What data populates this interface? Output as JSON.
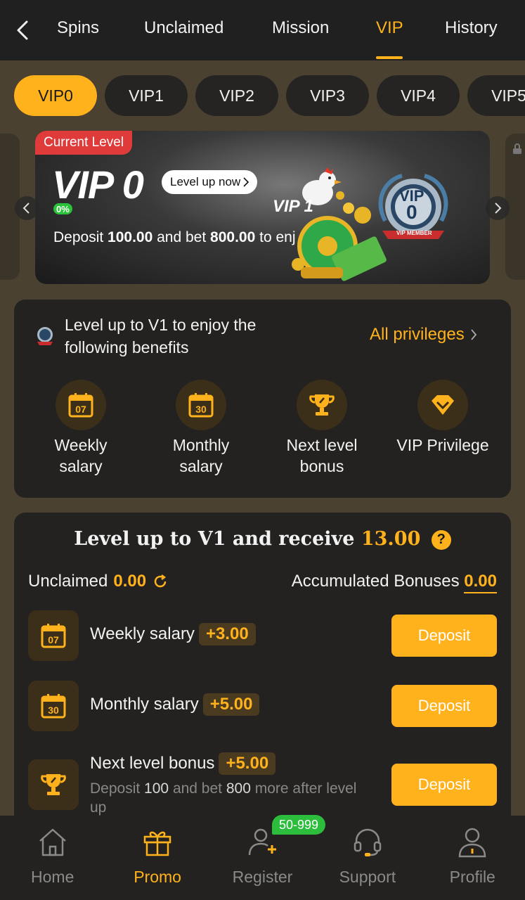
{
  "topnav": {
    "tabs": [
      {
        "label": "Spins"
      },
      {
        "label": "Unclaimed"
      },
      {
        "label": "Mission"
      },
      {
        "label": "VIP"
      },
      {
        "label": "History"
      }
    ],
    "active_tab": "VIP"
  },
  "vip_pills": [
    "VIP0",
    "VIP1",
    "VIP2",
    "VIP3",
    "VIP4",
    "VIP5"
  ],
  "active_pill": "VIP0",
  "banner": {
    "badge": "Current Level",
    "level": "VIP 0",
    "level_up_button": "Level up now",
    "progress": "0%",
    "progress_value": 0,
    "next_level_label": "VIP 1",
    "desc_prefix": "Deposit",
    "deposit_amount": "100.00",
    "desc_mid": "and bet",
    "bet_amount": "800.00",
    "desc_suffix": "to enj",
    "medal_text": "VIP",
    "medal_number": "0",
    "medal_ribbon": "VIP MEMBER"
  },
  "benefits": {
    "heading": "Level up to V1 to enjoy the following benefits",
    "all_privileges": "All privileges",
    "items": [
      {
        "label": "Weekly salary",
        "icon": "calendar-07-icon",
        "day": "07"
      },
      {
        "label": "Monthly salary",
        "icon": "calendar-30-icon",
        "day": "30"
      },
      {
        "label": "Next level bonus",
        "icon": "trophy-icon"
      },
      {
        "label": "VIP Privilege",
        "icon": "diamond-icon"
      }
    ]
  },
  "rewards": {
    "title_prefix": "Level up to V1 and receive",
    "title_amount": "13.00",
    "help": "?",
    "unclaimed_label": "Unclaimed",
    "unclaimed_value": "0.00",
    "accumulated_label": "Accumulated Bonuses",
    "accumulated_value": "0.00",
    "rows": [
      {
        "name": "Weekly salary",
        "amount": "+3.00",
        "button": "Deposit",
        "day": "07"
      },
      {
        "name": "Monthly salary",
        "amount": "+5.00",
        "button": "Deposit",
        "day": "30"
      },
      {
        "name": "Next level bonus",
        "amount": "+5.00",
        "button": "Deposit",
        "sub_prefix": "Deposit",
        "sub_deposit": "100",
        "sub_mid": "and bet",
        "sub_bet": "800",
        "sub_suffix": "more after level up"
      }
    ]
  },
  "bottombar": {
    "items": [
      {
        "label": "Home",
        "icon": "home-icon"
      },
      {
        "label": "Promo",
        "icon": "gift-icon"
      },
      {
        "label": "Register",
        "icon": "add-user-icon"
      },
      {
        "label": "Support",
        "icon": "headset-icon"
      },
      {
        "label": "Profile",
        "icon": "profile-icon"
      }
    ],
    "active": "Promo",
    "register_badge": "50-999"
  },
  "colors": {
    "accent": "#ffb21c",
    "page_bg": "#4a4131",
    "card_bg": "#232220",
    "badge_red": "#e03b3b",
    "progress_green": "#29c23a"
  }
}
